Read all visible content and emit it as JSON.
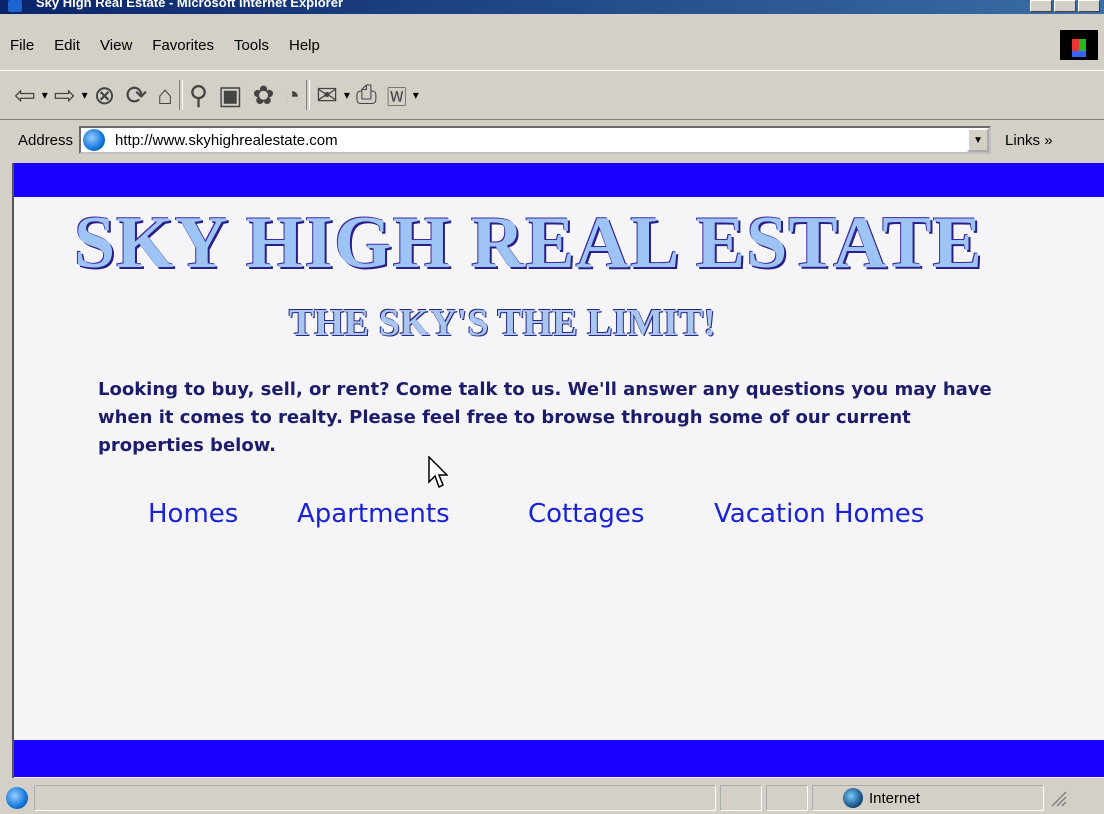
{
  "window": {
    "title": "Sky High Real Estate - Microsoft Internet Explorer"
  },
  "menu": [
    "File",
    "Edit",
    "View",
    "Favorites",
    "Tools",
    "Help"
  ],
  "toolbar": {
    "buttons": [
      "back-icon",
      "forward-icon",
      "stop-icon",
      "refresh-icon",
      "home-icon",
      "search-icon",
      "favorites-icon",
      "history-icon",
      "media-icon",
      "mail-icon",
      "print-icon",
      "word-icon"
    ]
  },
  "address": {
    "label": "Address",
    "url": "http://www.skyhighrealestate.com",
    "links_label": "Links »"
  },
  "page": {
    "title": "SKY HIGH REAL ESTATE",
    "tagline": "THE SKY'S THE LIMIT!",
    "intro": "Looking to buy, sell, or rent? Come talk to us. We'll answer any questions you may have when it comes to realty. Please feel free to browse through some of our current properties below.",
    "nav": [
      "Homes",
      "Apartments",
      "Cottages",
      "Vacation Homes"
    ],
    "colors": {
      "band": "#1a00ff",
      "link": "#1a22d8",
      "text": "#1c1c6a",
      "title": "#9ec3f5"
    }
  },
  "status": {
    "zone": "Internet"
  }
}
